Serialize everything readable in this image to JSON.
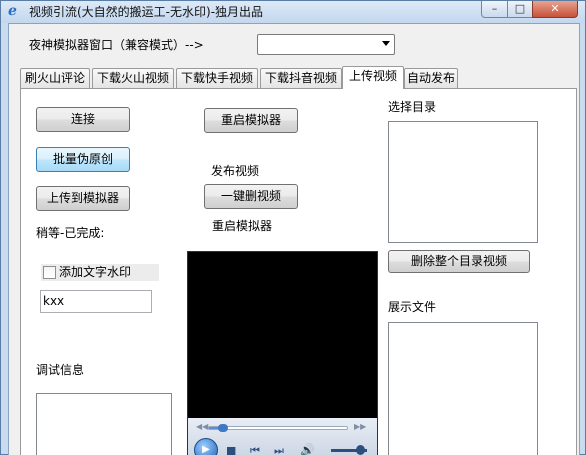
{
  "window": {
    "title": "视频引流(大自然的搬运工-无水印)-独月出品",
    "controls": {
      "minimize": "–",
      "maximize": "□",
      "close": "✕"
    }
  },
  "top": {
    "emulator_label": "夜神模拟器窗口（兼容模式）-->",
    "emulator_select_value": ""
  },
  "tabs": [
    {
      "label": "刷火山评论",
      "active": false
    },
    {
      "label": "下载火山视频",
      "active": false
    },
    {
      "label": "下载快手视频",
      "active": false
    },
    {
      "label": "下载抖音视频",
      "active": false
    },
    {
      "label": "上传视频",
      "active": true
    },
    {
      "label": "自动发布",
      "active": false
    }
  ],
  "panel": {
    "connect_button": "连接",
    "batch_button": "批量伪原创",
    "upload_button": "上传到模拟器",
    "status_label": "稍等-已完成:",
    "watermark_checkbox": {
      "label": "添加文字水印",
      "checked": false
    },
    "watermark_text": "kxx",
    "debug_label": "调试信息",
    "restart_button": "重启模拟器",
    "publish_label": "发布视频",
    "delete_button": "一键删视频",
    "restart_label": "重启模拟器",
    "select_dir_label": "选择目录",
    "delete_dir_button": "删除整个目录视频",
    "show_files_label": "展示文件"
  },
  "player": {
    "progress": 0.08,
    "volume": 0.8,
    "icons": [
      "play-icon",
      "stop-icon",
      "previous-icon",
      "next-icon",
      "volume-icon"
    ]
  },
  "colors": {
    "title_bar": "#c3d7ee",
    "focused_button": "#bee6fd",
    "close_button": "#c7513a",
    "player_bg": "#000000"
  }
}
